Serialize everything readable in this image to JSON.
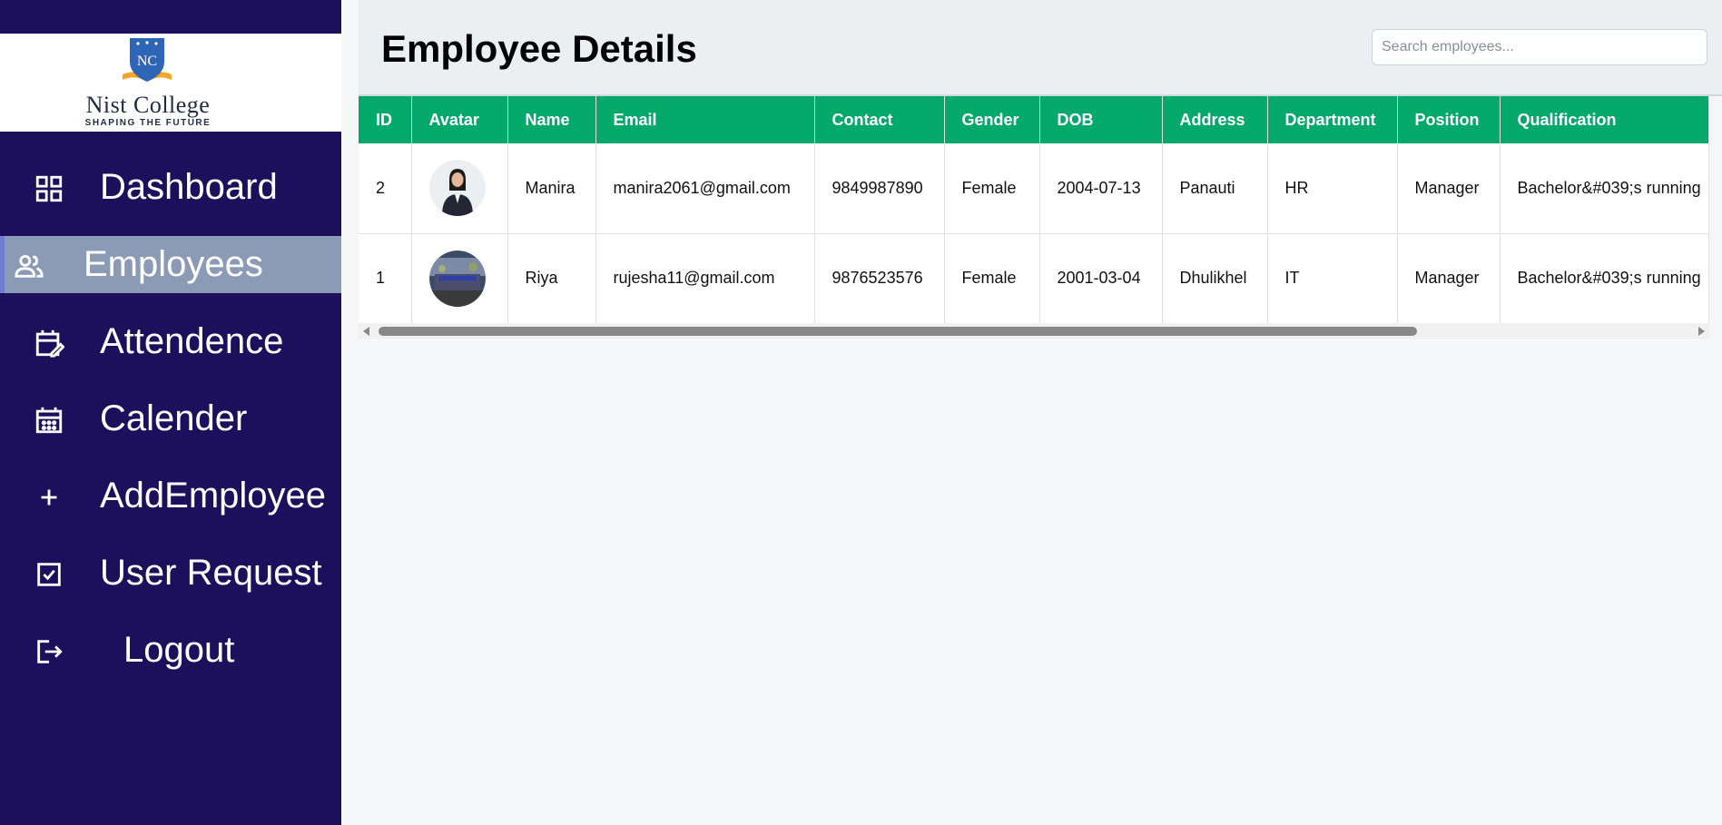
{
  "sidebar": {
    "logo": {
      "title": "Nist College",
      "tagline": "SHAPING THE FUTURE",
      "emblem_text": "NC"
    },
    "items": [
      {
        "label": "Dashboard",
        "icon": "dashboard-grid-icon"
      },
      {
        "label": "Employees",
        "icon": "people-icon",
        "active": true
      },
      {
        "label": "Attendence",
        "icon": "calendar-edit-icon"
      },
      {
        "label": "Calender",
        "icon": "calendar-icon"
      },
      {
        "label": "AddEmployee",
        "icon": "plus-icon"
      },
      {
        "label": "User Request",
        "icon": "checkbox-icon"
      },
      {
        "label": "Logout",
        "icon": "logout-icon"
      }
    ]
  },
  "header": {
    "title": "Employee Details",
    "search_placeholder": "Search employees..."
  },
  "table": {
    "columns": [
      "ID",
      "Avatar",
      "Name",
      "Email",
      "Contact",
      "Gender",
      "DOB",
      "Address",
      "Department",
      "Position",
      "Qualification"
    ],
    "rows": [
      {
        "id": "2",
        "name": "Manira",
        "email": "manira2061@gmail.com",
        "contact": "9849987890",
        "gender": "Female",
        "dob": "2004-07-13",
        "address": "Panauti",
        "department": "HR",
        "position": "Manager",
        "qualification": "Bachelor&#039;s running"
      },
      {
        "id": "1",
        "name": "Riya",
        "email": "rujesha11@gmail.com",
        "contact": "9876523576",
        "gender": "Female",
        "dob": "2001-03-04",
        "address": "Dhulikhel",
        "department": "IT",
        "position": "Manager",
        "qualification": "Bachelor&#039;s running"
      }
    ]
  },
  "colors": {
    "sidebar_bg": "#1c0f5b",
    "active_item_bg": "#8c9bb5",
    "table_header_bg": "#03a86b"
  }
}
